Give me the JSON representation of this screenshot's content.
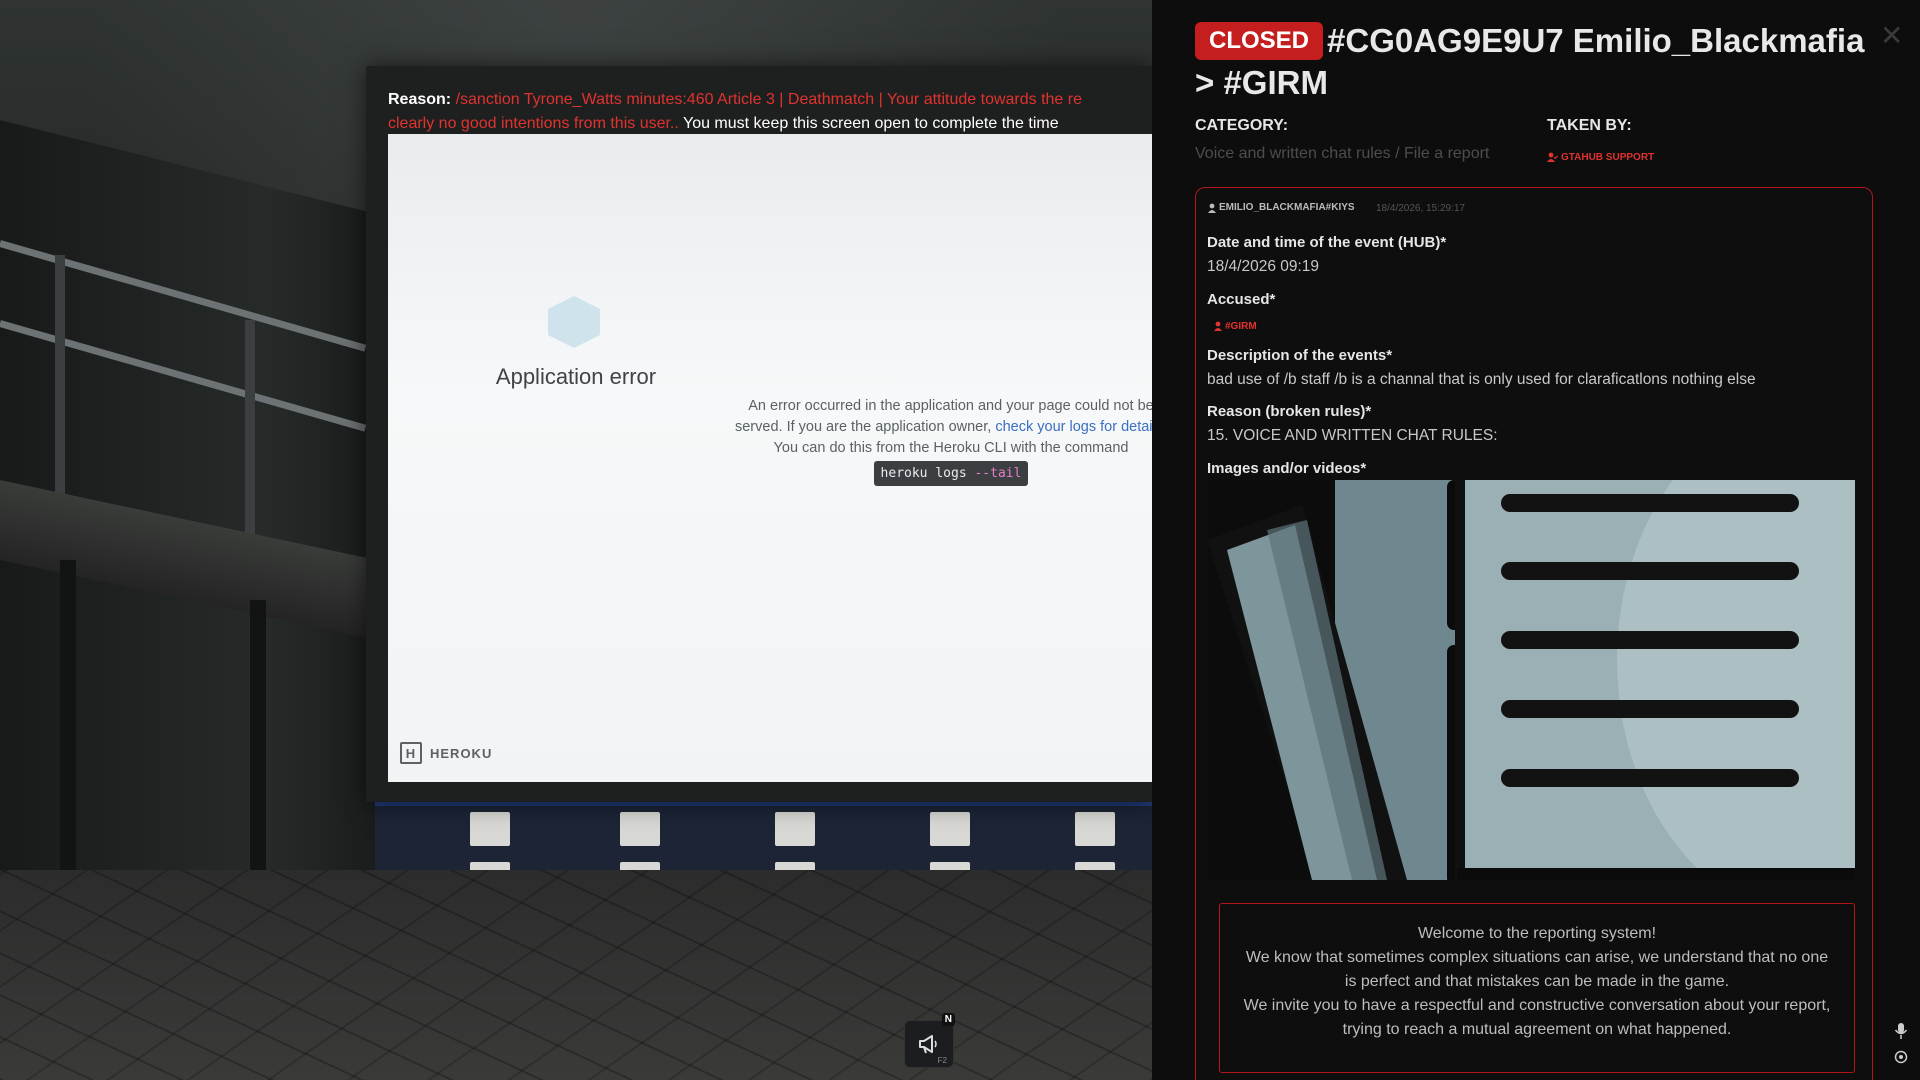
{
  "overlay": {
    "reason_label": "Reason:",
    "reason_text_line1": " /sanction Tyrone_Watts minutes:460 Article 3 | Deathmatch | Your attitude towards the re",
    "reason_text_line2": "clearly no good intentions from this user..",
    "reason_suffix": " You must keep this screen open to complete the time"
  },
  "webpage": {
    "error_title": "Application error",
    "error_line1": "An error occurred in the application and your page could not be",
    "error_line2_pre": "served. If you are the application owner, ",
    "error_link": "check your logs for details",
    "error_line2_post": ".",
    "error_line3": "You can do this from the Heroku CLI with the command",
    "cmd_main": "heroku logs ",
    "cmd_flag": "--tail",
    "brand": "HEROKU",
    "brand_glyph": "H"
  },
  "hud": {
    "icon": "megaphone-icon",
    "notify_key": "N",
    "hotkey": "F2"
  },
  "report": {
    "status": "CLOSED",
    "title": "#CG0AG9E9U7 Emilio_Blackmafia > #GIRM",
    "category_label": "CATEGORY:",
    "category_value": "Voice and written chat rules / File a report",
    "taken_by_label": "TAKEN BY:",
    "taken_by_value": "GTAHUB SUPPORT",
    "author": "EMILIO_BLACKMAFIA#KIYS",
    "timestamp": "18/4/2026, 15:29:17",
    "fields": [
      {
        "label": "Date and time of the event (HUB)*",
        "value": "18/4/2026 09:19"
      },
      {
        "label": "Accused*",
        "value": "#GIRM"
      },
      {
        "label": "Description of the events*",
        "value": "bad use of /b staff /b is a channal that is only used for claraficatlons nothing else"
      },
      {
        "label": "Reason (broken rules)*",
        "value": "15. VOICE AND WRITTEN CHAT RULES:"
      },
      {
        "label": "Images and/or videos*",
        "value": ""
      }
    ],
    "welcome": [
      "Welcome to the reporting system!",
      "We know that sometimes complex situations can arise, we understand that no one is perfect and that mistakes can be made in the game.",
      "We invite you to have a respectful and constructive conversation about your report, trying to reach a mutual agreement on what happened."
    ],
    "accent_color": "#c41e1e"
  }
}
